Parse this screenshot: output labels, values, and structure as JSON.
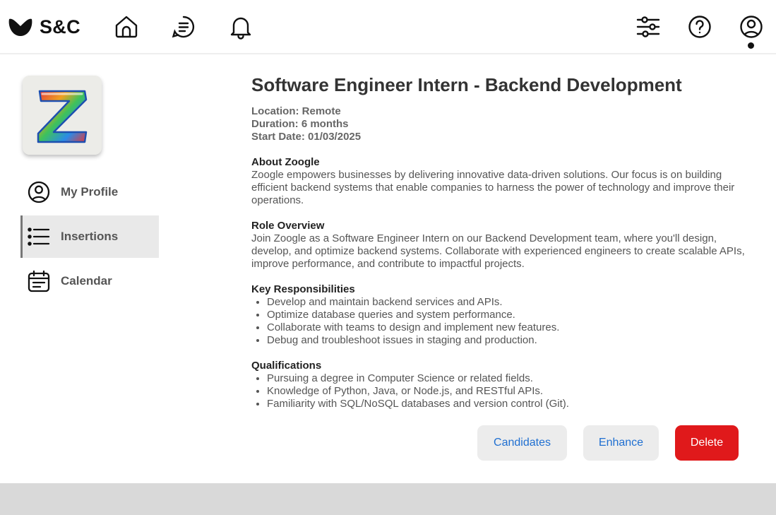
{
  "brand": {
    "name": "S&C"
  },
  "nav": {
    "icons": [
      "home-icon",
      "messages-icon",
      "bell-icon",
      "filters-icon",
      "help-icon",
      "profile-icon"
    ],
    "active": "profile-icon"
  },
  "sidebar": {
    "logo_icon": "zoogle-logo-icon",
    "items": [
      {
        "label": "My Profile",
        "icon": "user-circle-icon",
        "active": false
      },
      {
        "label": "Insertions",
        "icon": "list-icon",
        "active": true
      },
      {
        "label": "Calendar",
        "icon": "calendar-icon",
        "active": false
      }
    ]
  },
  "job": {
    "title": "Software Engineer Intern - Backend Development",
    "location": "Location: Remote",
    "duration": "Duration: 6 months",
    "start_date": "Start Date: 01/03/2025",
    "about": {
      "heading": "About Zoogle",
      "text": "Zoogle empowers businesses by delivering innovative data-driven solutions. Our focus is on building efficient backend systems that enable companies to harness the power of technology and improve their operations."
    },
    "role": {
      "heading": "Role Overview",
      "text": "Join Zoogle as a Software Engineer Intern on our Backend Development team, where you'll design, develop, and optimize backend systems. Collaborate with experienced engineers to create scalable APIs, improve performance, and contribute to impactful projects."
    },
    "responsibilities": {
      "heading": "Key Responsibilities",
      "items": [
        "Develop and maintain backend services and APIs.",
        "Optimize database queries and system performance.",
        "Collaborate with teams to design and implement new features.",
        "Debug and troubleshoot issues in staging and production."
      ]
    },
    "qualifications": {
      "heading": "Qualifications",
      "items": [
        "Pursuing a degree in Computer Science or related fields.",
        "Knowledge of Python, Java, or Node.js, and RESTful APIs.",
        "Familiarity with SQL/NoSQL databases and version control (Git)."
      ]
    }
  },
  "actions": {
    "candidates": "Candidates",
    "enhance": "Enhance",
    "delete": "Delete"
  },
  "colors": {
    "accent": "#1f6fd1",
    "danger": "#e0191b",
    "active_bg": "#e9e9e9",
    "footer": "#d9d9d9"
  }
}
